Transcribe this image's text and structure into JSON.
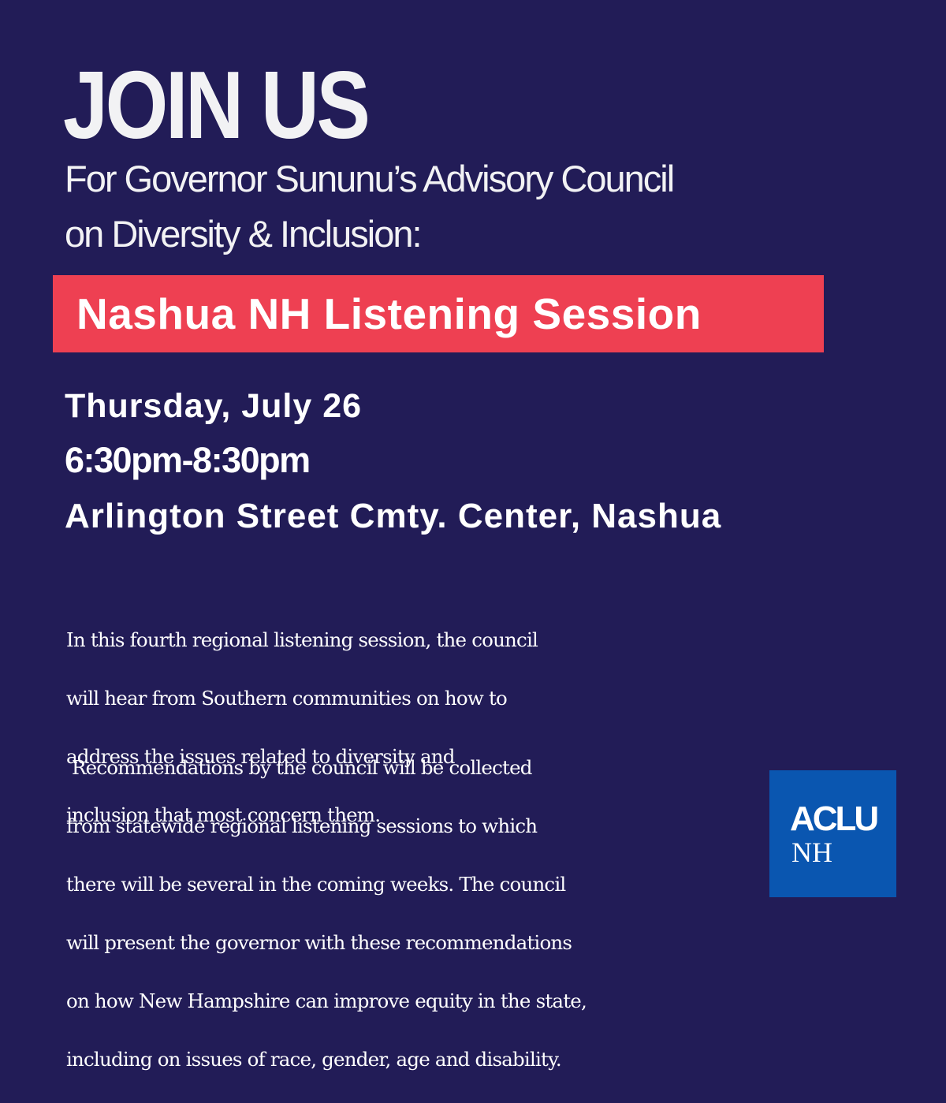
{
  "headline": "JOIN US",
  "subheading": {
    "line1": "For Governor Sununu’s Advisory Council",
    "line2": "on Diversity & Inclusion:"
  },
  "banner": {
    "text": "Nashua NH Listening Session",
    "color": "#ee4052"
  },
  "event": {
    "date": "Thursday, July 26",
    "time": "6:30pm-8:30pm",
    "location": "Arlington Street Cmty. Center, Nashua"
  },
  "description": {
    "paragraph1": [
      "In this fourth regional listening session, the council",
      "will hear from Southern communities on how to",
      "address the issues related to diversity and",
      "inclusion that most concern them."
    ],
    "paragraph2": [
      " Recommendations by the council will be collected",
      "from statewide regional listening sessions to which",
      "there will be several in the coming weeks. The council",
      "will present the governor with these recommendations",
      "on how New Hampshire can improve equity in the state,",
      "including on issues of race, gender, age and disability."
    ]
  },
  "logo": {
    "name": "ACLU",
    "region": "NH",
    "color": "#0a56b0"
  },
  "colors": {
    "background": "#221c57",
    "text": "#ffffff"
  }
}
